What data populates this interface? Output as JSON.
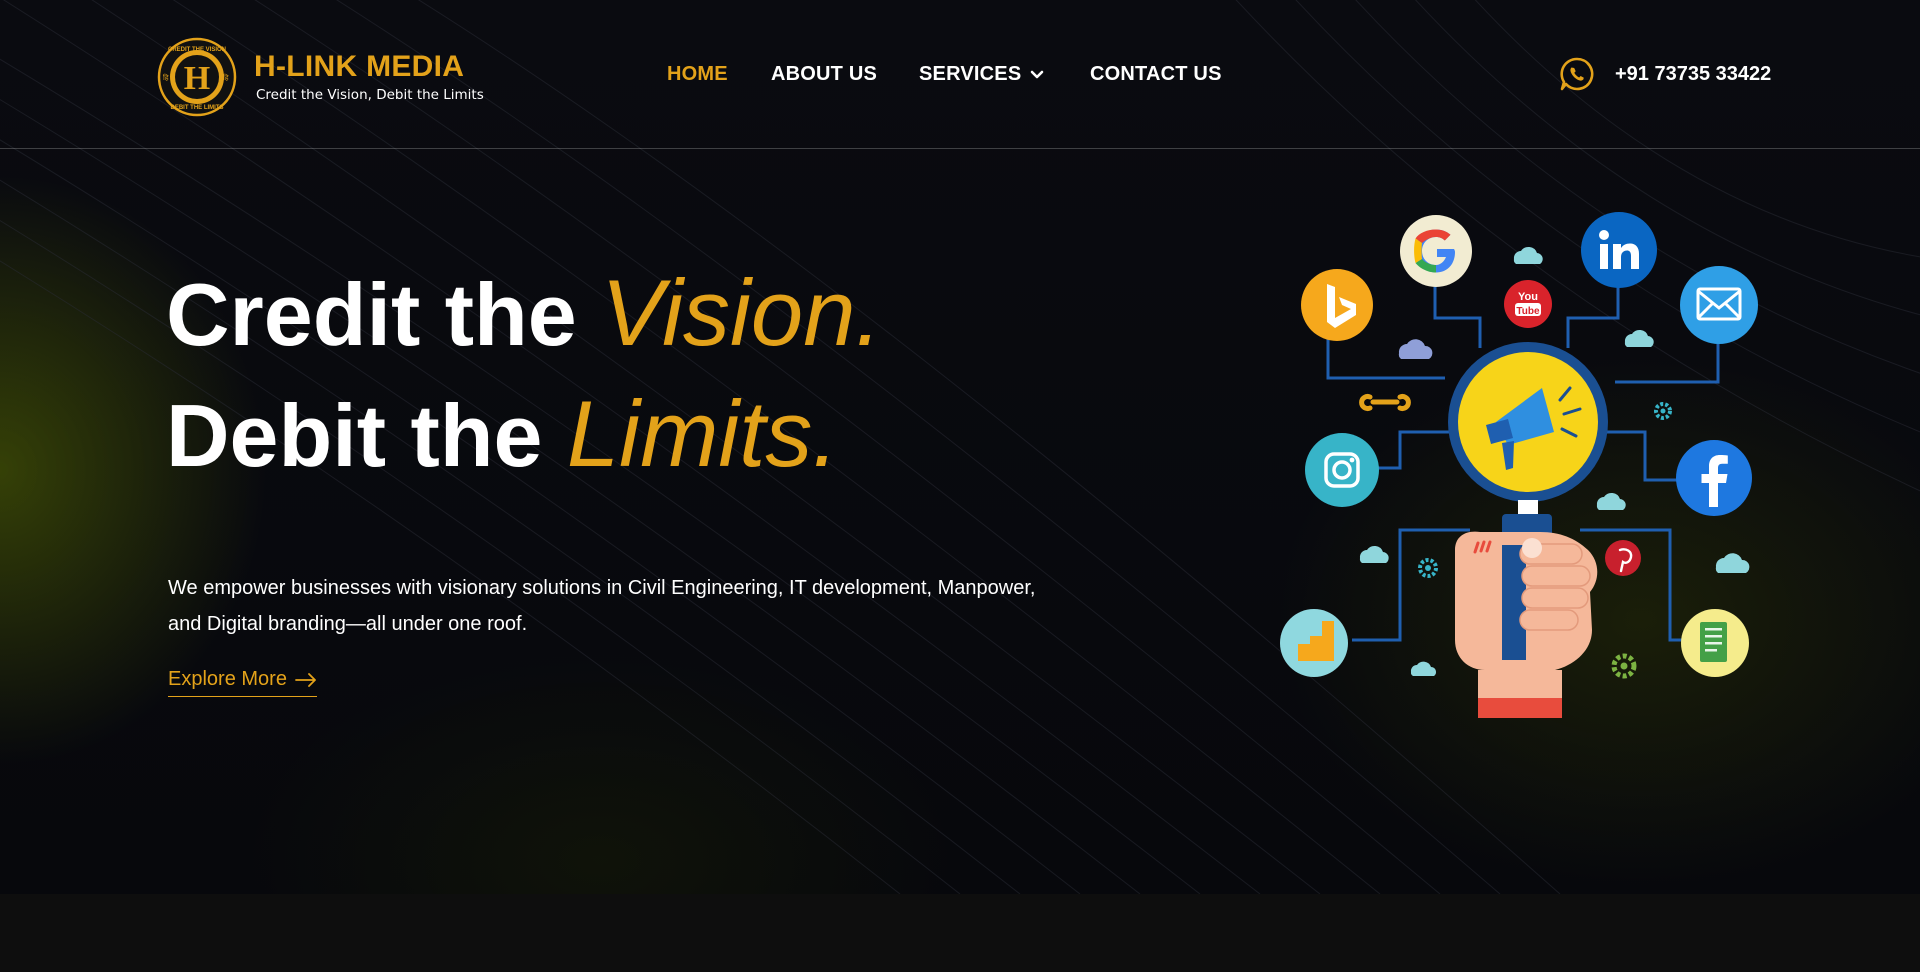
{
  "brand": {
    "name": "H-LINK MEDIA",
    "tagline": "Credit the Vision, Debit the Limits",
    "logo_text_top": "CREDIT THE VISION",
    "logo_text_bottom": "DEBIT THE LIMITS",
    "logo_letter": "H",
    "logo_side_left": "हि",
    "logo_side_right": "हि"
  },
  "nav": {
    "items": [
      {
        "label": "HOME",
        "active": true
      },
      {
        "label": "ABOUT US",
        "active": false
      },
      {
        "label": "SERVICES",
        "active": false
      },
      {
        "label": "CONTACT US",
        "active": false
      }
    ]
  },
  "contact": {
    "phone": "+91 73735 33422",
    "icon": "whatsapp-icon"
  },
  "hero": {
    "line1_plain": "Credit the ",
    "line1_accent": "Vision.",
    "line2_plain": "Debit the ",
    "line2_accent": "Limits.",
    "description": "We empower businesses with visionary solutions in Civil Engineering, IT development, Manpower, and Digital branding—all under one roof.",
    "cta_label": "Explore More"
  },
  "illustration": {
    "icons": [
      "bing-icon",
      "google-icon",
      "youtube-icon",
      "linkedin-icon",
      "email-icon",
      "instagram-icon",
      "facebook-icon",
      "analytics-icon",
      "pinterest-icon",
      "document-icon",
      "megaphone-icon",
      "magnifier-hand-icon",
      "wrench-icon",
      "gear-icon",
      "cloud-icon"
    ],
    "youtube_text_top": "You",
    "youtube_text_bottom": "Tube"
  },
  "colors": {
    "accent": "#e3a21a",
    "background": "#08090d",
    "text": "#ffffff"
  }
}
